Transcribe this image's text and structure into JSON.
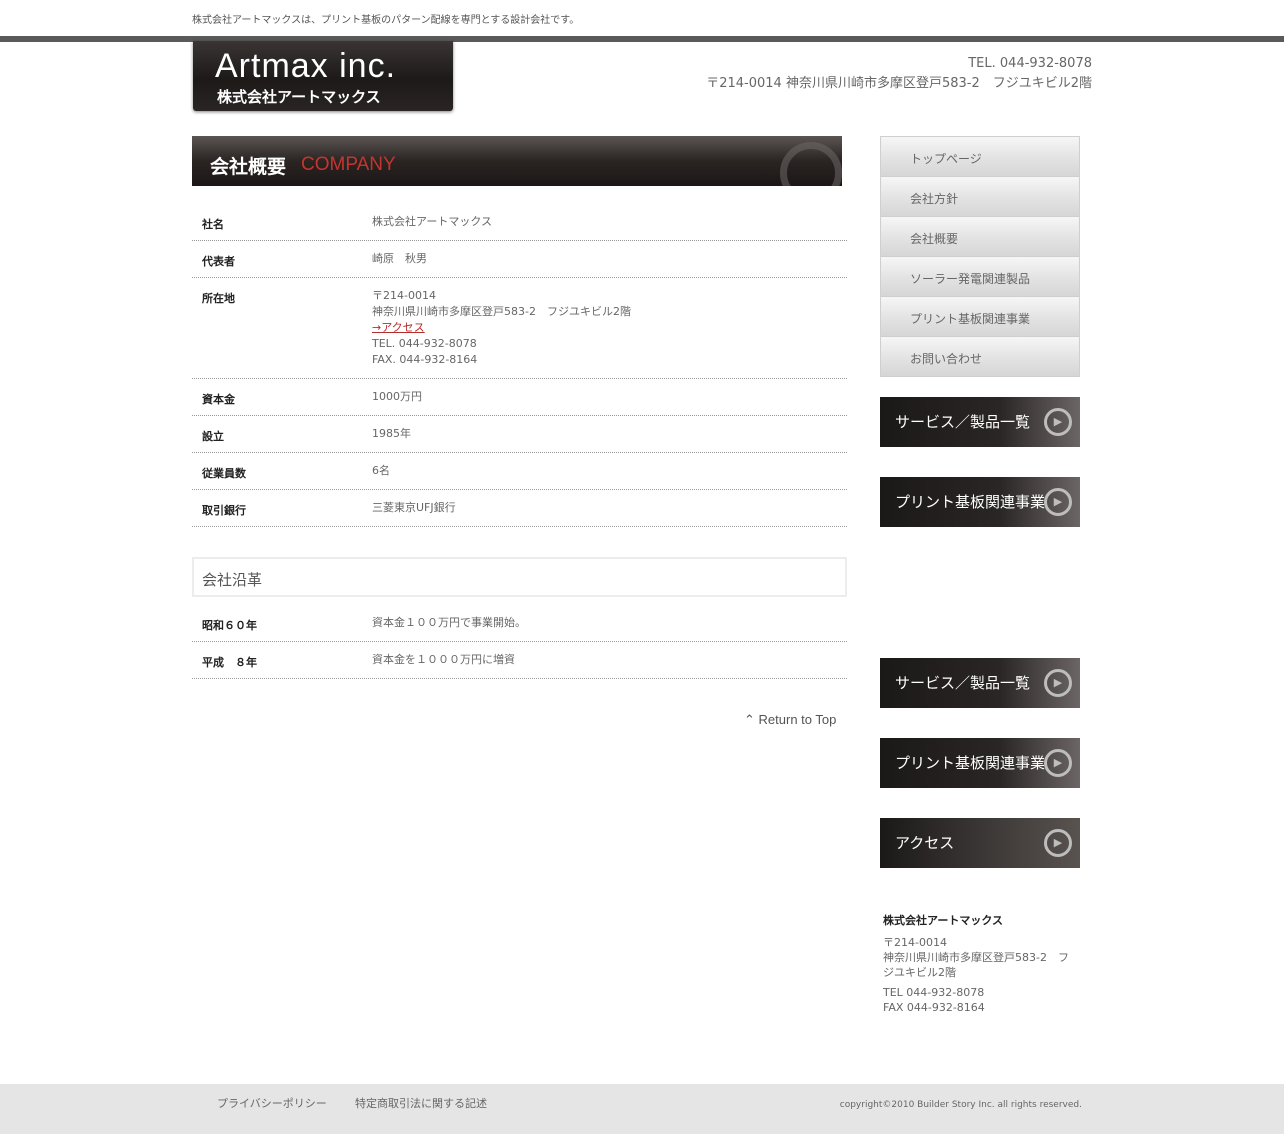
{
  "header": {
    "tagline": "株式会社アートマックスは、プリント基板のパターン配線を専門とする設計会社です。",
    "logo_en": "Artmax inc.",
    "logo_ja": "株式会社アートマックス",
    "tel": "TEL. 044-932-8078",
    "address": "〒214-0014 神奈川県川崎市多摩区登戸583-2　フジユキビル2階"
  },
  "page_heading": {
    "ja": "会社概要",
    "en": "COMPANY"
  },
  "company_table": [
    {
      "label": "社名",
      "value": "株式会社アートマックス"
    },
    {
      "label": "代表者",
      "value": "崎原　秋男"
    },
    {
      "label": "所在地",
      "postal": "〒214-0014",
      "address": "神奈川県川崎市多摩区登戸583-2　フジユキビル2階",
      "access_link": "→アクセス",
      "tel": "TEL. 044-932-8078",
      "fax": "FAX. 044-932-8164"
    },
    {
      "label": "資本金",
      "value": "1000万円"
    },
    {
      "label": "設立",
      "value": "1985年"
    },
    {
      "label": "従業員数",
      "value": "6名"
    },
    {
      "label": "取引銀行",
      "value": "三菱東京UFJ銀行"
    }
  ],
  "history_heading": "会社沿革",
  "history": [
    {
      "label": "昭和６０年",
      "value": "資本金１００万円で事業開始。"
    },
    {
      "label": "平成　８年",
      "value": "資本金を１０００万円に増資"
    }
  ],
  "return_to_top": "Return to Top",
  "sidebar": {
    "nav": [
      "トップページ",
      "会社方針",
      "会社概要",
      "ソーラー発電関連製品",
      "プリント基板関連事業",
      "お問い合わせ"
    ],
    "banners": [
      "サービス／製品一覧",
      "プリント基板関連事業",
      "サービス／製品一覧",
      "プリント基板関連事業",
      "アクセス"
    ],
    "address_block": {
      "name": "株式会社アートマックス",
      "postal": "〒214-0014",
      "address": "神奈川県川崎市多摩区登戸583-2　フジユキビル2階",
      "tel": "TEL 044-932-8078",
      "fax": "FAX 044-932-8164"
    }
  },
  "footer": {
    "privacy": "プライバシーポリシー",
    "tokutei": "特定商取引法に関する記述",
    "copyright": "copyright©2010 Builder Story Inc. all rights reserved."
  }
}
